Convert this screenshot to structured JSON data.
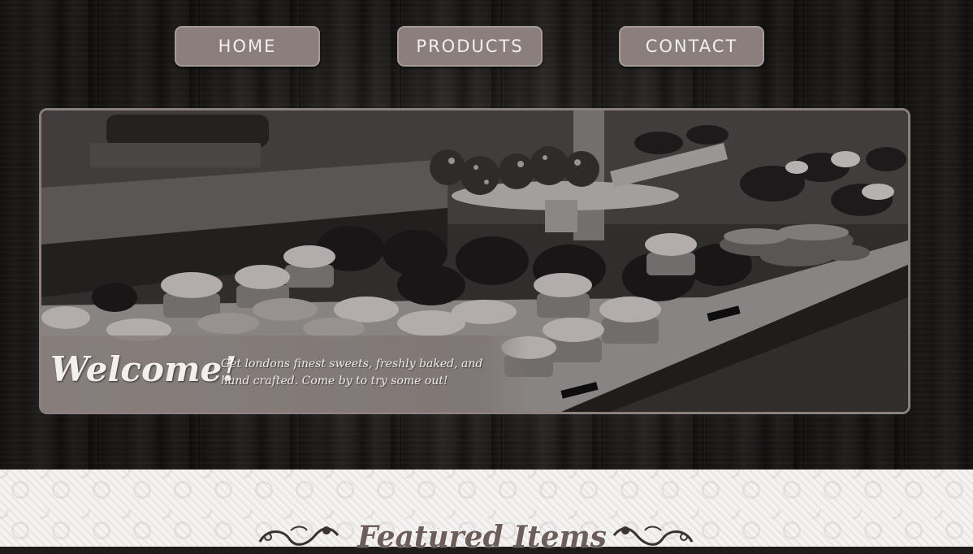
{
  "nav": {
    "home": "HOME",
    "products": "PRODUCTS",
    "contact": "CONTACT"
  },
  "hero": {
    "welcome_title": "Welcome!",
    "welcome_text": "Get londons finest sweets, freshly baked, and hand crafted. Come by to try some out!",
    "image": "bakery-display-case-photo"
  },
  "featured": {
    "title": "Featured Items"
  },
  "colors": {
    "button_bg": "#8a7f7d",
    "button_text": "#f2efee",
    "featured_title": "#6d5e5c",
    "hero_border": "#8a807d"
  }
}
